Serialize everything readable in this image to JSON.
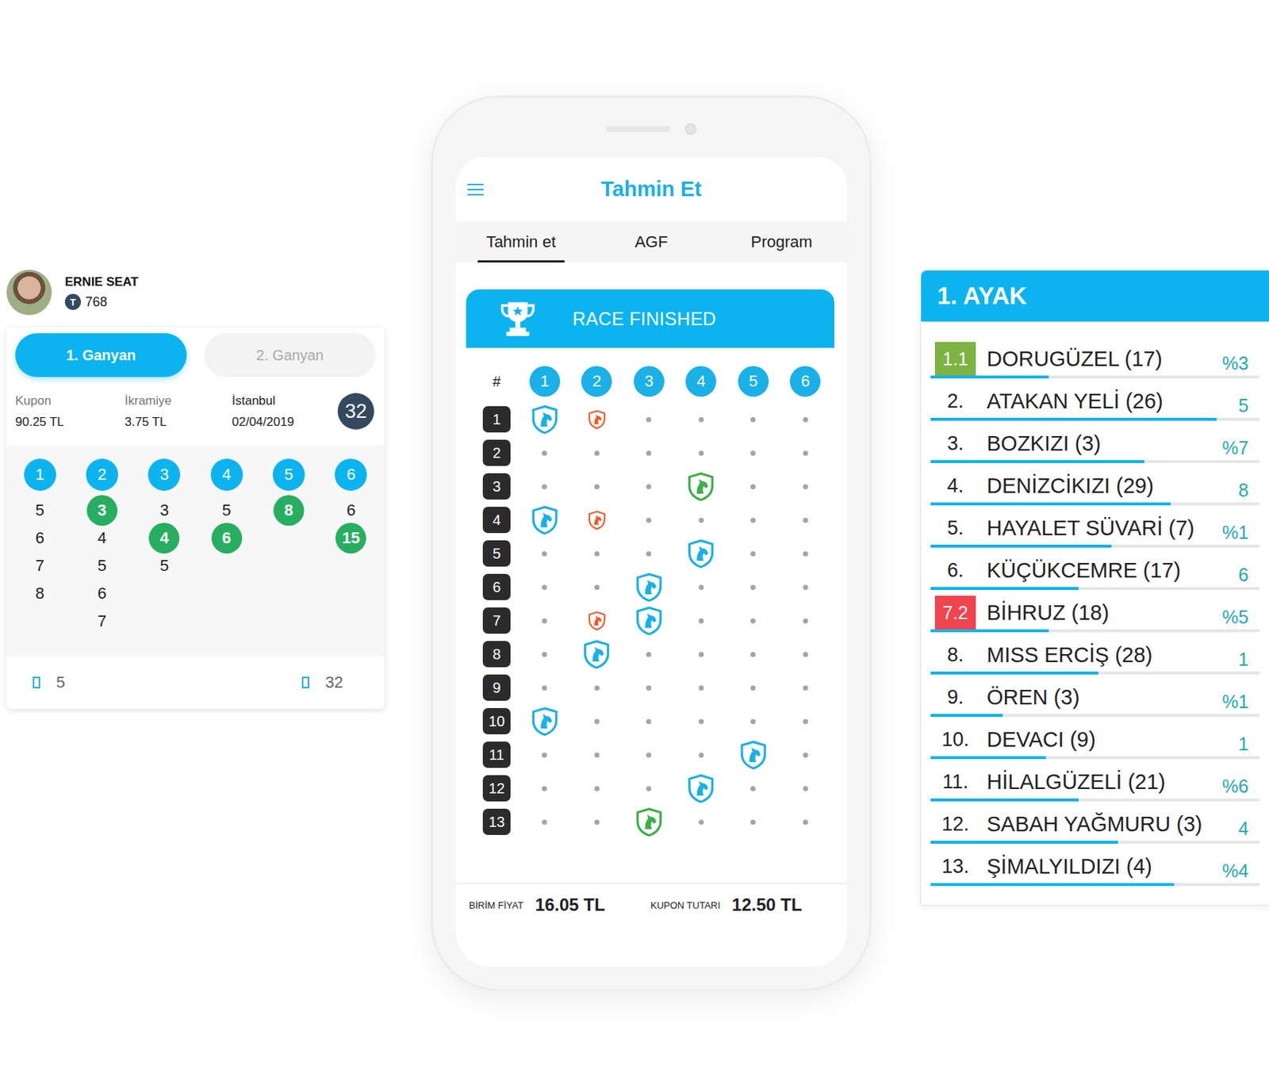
{
  "user": {
    "name": "ERNIE SEAT",
    "token_icon": "T",
    "points": "768"
  },
  "ganyan_tabs": [
    {
      "label": "1. Ganyan",
      "selected": true
    },
    {
      "label": "2. Ganyan",
      "selected": false
    }
  ],
  "coupon_info": [
    {
      "label": "Kupon",
      "value": "90.25 TL"
    },
    {
      "label": "İkramiye",
      "value": "3.75 TL"
    },
    {
      "label": "İstanbul",
      "value": "02/04/2019"
    }
  ],
  "coupon_badge": "32",
  "legs": [
    {
      "header": "1",
      "picks": [
        {
          "num": "5",
          "won": false
        },
        {
          "num": "6",
          "won": false
        },
        {
          "num": "7",
          "won": false
        },
        {
          "num": "8",
          "won": false
        }
      ]
    },
    {
      "header": "2",
      "picks": [
        {
          "num": "3",
          "won": true
        },
        {
          "num": "4",
          "won": false
        },
        {
          "num": "5",
          "won": false
        },
        {
          "num": "6",
          "won": false
        },
        {
          "num": "7",
          "won": false
        }
      ]
    },
    {
      "header": "3",
      "picks": [
        {
          "num": "3",
          "won": false
        },
        {
          "num": "4",
          "won": true
        },
        {
          "num": "5",
          "won": false
        }
      ]
    },
    {
      "header": "4",
      "picks": [
        {
          "num": "5",
          "won": false
        },
        {
          "num": "6",
          "won": true
        }
      ]
    },
    {
      "header": "5",
      "picks": [
        {
          "num": "8",
          "won": true
        }
      ]
    },
    {
      "header": "6",
      "picks": [
        {
          "num": "6",
          "won": false
        },
        {
          "num": "15",
          "won": true
        }
      ]
    }
  ],
  "coupon_footer": [
    {
      "value": "5"
    },
    {
      "value": "32"
    }
  ],
  "phone": {
    "title": "Tahmin Et",
    "tabs": [
      {
        "label": "Tahmin et",
        "selected": true
      },
      {
        "label": "AGF",
        "selected": false
      },
      {
        "label": "Program",
        "selected": false
      }
    ],
    "banner": "RACE FINISHED",
    "grid_corner": "#",
    "columns": [
      "1",
      "2",
      "3",
      "4",
      "5",
      "6"
    ],
    "rows": [
      {
        "num": "1",
        "cells": [
          {
            "kind": "shield",
            "color": "#1ab0e8"
          },
          {
            "kind": "small-shield",
            "color": "#f05a28"
          },
          {
            "kind": "dot"
          },
          {
            "kind": "dot"
          },
          {
            "kind": "dot"
          },
          {
            "kind": "dot"
          }
        ]
      },
      {
        "num": "2",
        "cells": [
          {
            "kind": "dot"
          },
          {
            "kind": "dot"
          },
          {
            "kind": "dot"
          },
          {
            "kind": "dot"
          },
          {
            "kind": "dot"
          },
          {
            "kind": "dot"
          }
        ]
      },
      {
        "num": "3",
        "cells": [
          {
            "kind": "dot"
          },
          {
            "kind": "dot"
          },
          {
            "kind": "dot"
          },
          {
            "kind": "shield",
            "color": "#3cae4a"
          },
          {
            "kind": "dot"
          },
          {
            "kind": "dot"
          }
        ]
      },
      {
        "num": "4",
        "cells": [
          {
            "kind": "shield",
            "color": "#1ab0e8"
          },
          {
            "kind": "small-shield",
            "color": "#f05a28"
          },
          {
            "kind": "dot"
          },
          {
            "kind": "dot"
          },
          {
            "kind": "dot"
          },
          {
            "kind": "dot"
          }
        ]
      },
      {
        "num": "5",
        "cells": [
          {
            "kind": "dot"
          },
          {
            "kind": "dot"
          },
          {
            "kind": "dot"
          },
          {
            "kind": "shield",
            "color": "#1ab0e8"
          },
          {
            "kind": "dot"
          },
          {
            "kind": "dot"
          }
        ]
      },
      {
        "num": "6",
        "cells": [
          {
            "kind": "dot"
          },
          {
            "kind": "dot"
          },
          {
            "kind": "shield",
            "color": "#1ab0e8"
          },
          {
            "kind": "dot"
          },
          {
            "kind": "dot"
          },
          {
            "kind": "dot"
          }
        ]
      },
      {
        "num": "7",
        "cells": [
          {
            "kind": "dot"
          },
          {
            "kind": "small-shield",
            "color": "#f05a28"
          },
          {
            "kind": "shield",
            "color": "#1ab0e8"
          },
          {
            "kind": "dot"
          },
          {
            "kind": "dot"
          },
          {
            "kind": "dot"
          }
        ]
      },
      {
        "num": "8",
        "cells": [
          {
            "kind": "dot"
          },
          {
            "kind": "shield",
            "color": "#1ab0e8"
          },
          {
            "kind": "dot"
          },
          {
            "kind": "dot"
          },
          {
            "kind": "dot"
          },
          {
            "kind": "dot"
          }
        ]
      },
      {
        "num": "9",
        "cells": [
          {
            "kind": "dot"
          },
          {
            "kind": "dot"
          },
          {
            "kind": "dot"
          },
          {
            "kind": "dot"
          },
          {
            "kind": "dot"
          },
          {
            "kind": "dot"
          }
        ]
      },
      {
        "num": "10",
        "cells": [
          {
            "kind": "shield",
            "color": "#1ab0e8"
          },
          {
            "kind": "dot"
          },
          {
            "kind": "dot"
          },
          {
            "kind": "dot"
          },
          {
            "kind": "dot"
          },
          {
            "kind": "dot"
          }
        ]
      },
      {
        "num": "11",
        "cells": [
          {
            "kind": "dot"
          },
          {
            "kind": "dot"
          },
          {
            "kind": "dot"
          },
          {
            "kind": "dot"
          },
          {
            "kind": "shield",
            "color": "#1ab0e8"
          },
          {
            "kind": "dot"
          }
        ]
      },
      {
        "num": "12",
        "cells": [
          {
            "kind": "dot"
          },
          {
            "kind": "dot"
          },
          {
            "kind": "dot"
          },
          {
            "kind": "shield",
            "color": "#1ab0e8"
          },
          {
            "kind": "dot"
          },
          {
            "kind": "dot"
          }
        ]
      },
      {
        "num": "13",
        "cells": [
          {
            "kind": "dot"
          },
          {
            "kind": "dot"
          },
          {
            "kind": "shield",
            "color": "#3cae4a"
          },
          {
            "kind": "dot"
          },
          {
            "kind": "dot"
          },
          {
            "kind": "dot"
          }
        ]
      }
    ],
    "footer": [
      {
        "label": "BİRİM FİYAT",
        "value": "16.05 TL"
      },
      {
        "label": "KUPON TUTARI",
        "value": "12.50 TL"
      }
    ]
  },
  "leg_panel": {
    "title": "1. AYAK",
    "horses": [
      {
        "kind": "badge",
        "rank": "1.1",
        "color": "#7cb342",
        "name": "DORUGÜZEL (17)",
        "value": "%3",
        "level": 0.36
      },
      {
        "kind": "plain",
        "rank": "2.",
        "name": "ATAKAN YELİ (26)",
        "value": "5",
        "level": 0.87
      },
      {
        "kind": "plain",
        "rank": "3.",
        "name": "BOZKIZI (3)",
        "value": "%7",
        "level": 0.65
      },
      {
        "kind": "plain",
        "rank": "4.",
        "name": "DENİZCİKIZI (29)",
        "value": "8",
        "level": 0.73
      },
      {
        "kind": "plain",
        "rank": "5.",
        "name": "HAYALET SÜVARİ (7)",
        "value": "%1",
        "level": 0.55
      },
      {
        "kind": "plain",
        "rank": "6.",
        "name": "KÜÇÜKCEMRE (17)",
        "value": "6",
        "level": 0.45
      },
      {
        "kind": "badge",
        "rank": "7.2",
        "color": "#f0444f",
        "name": "BİHRUZ (18)",
        "value": "%5",
        "level": 0.36
      },
      {
        "kind": "plain",
        "rank": "8.",
        "name": "MISS ERCİŞ (28)",
        "value": "1",
        "level": 0.51
      },
      {
        "kind": "plain",
        "rank": "9.",
        "name": "ÖREN (3)",
        "value": "%1",
        "level": 0.22
      },
      {
        "kind": "plain",
        "rank": "10.",
        "name": "DEVACI (9)",
        "value": "1",
        "level": 0.35
      },
      {
        "kind": "plain",
        "rank": "11.",
        "name": "HİLALGÜZELİ (21)",
        "value": "%6",
        "level": 0.45
      },
      {
        "kind": "plain",
        "rank": "12.",
        "name": "SABAH YAĞMURU (3)",
        "value": "4",
        "level": 0.57
      },
      {
        "kind": "plain",
        "rank": "13.",
        "name": "ŞİMALYILDIZI (4)",
        "value": "%4",
        "level": 0.74
      }
    ]
  }
}
